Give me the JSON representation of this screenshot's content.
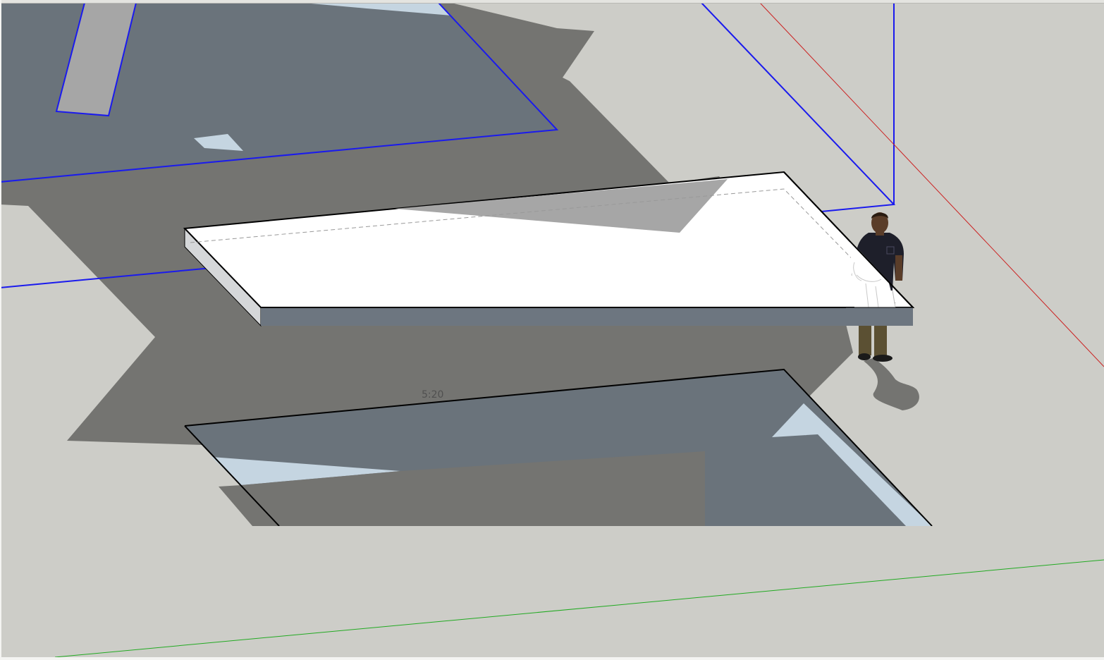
{
  "app": {
    "viewport_type": "3D modeling viewport"
  },
  "scene": {
    "annotation_label": "5:20",
    "colors": {
      "ground": "#cdcdc8",
      "shadow": "#747471",
      "shadow_on_face": "#6a737b",
      "face_highlight": "#c5d5e1",
      "face_white": "#ffffff",
      "slab_front": "#6d7680",
      "slab_side": "#d5d7d9",
      "slab_shadow_band": "#a6a6a6",
      "edge_black": "#000000",
      "blue_axis": "#1a1aee",
      "red_axis": "#cc2222",
      "green_axis": "#22aa22",
      "person_shirt": "#1e1f2a",
      "person_pants": "#5b5033",
      "person_skin": "#5a3d29"
    },
    "entities": [
      "slab-component",
      "human-figure",
      "lower-rectangle-face",
      "upper-blue-rectangle",
      "upper-small-post",
      "red-axis-line",
      "green-axis-line"
    ]
  }
}
